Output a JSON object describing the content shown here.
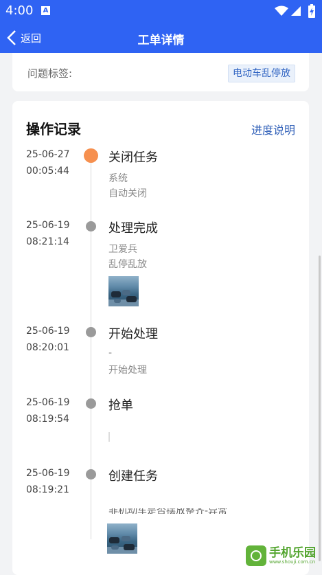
{
  "status_bar": {
    "time": "4:00",
    "notification_letter": "A"
  },
  "app_bar": {
    "back_label": "返回",
    "title": "工单详情"
  },
  "tag_card": {
    "label": "问题标签:",
    "tag": "电动车乱停放"
  },
  "log": {
    "title": "操作记录",
    "progress_link": "进度说明",
    "entries": [
      {
        "date": "25-06-27",
        "time": "00:05:44",
        "action": "关闭任务",
        "line1": "系统",
        "line2": "自动关闭"
      },
      {
        "date": "25-06-19",
        "time": "08:21:14",
        "action": "处理完成",
        "line1": "卫爱兵",
        "line2": "乱停乱放"
      },
      {
        "date": "25-06-19",
        "time": "08:20:01",
        "action": "开始处理",
        "line1": "-",
        "line2": "开始处理"
      },
      {
        "date": "25-06-19",
        "time": "08:19:54",
        "action": "抢单"
      },
      {
        "date": "25-06-19",
        "time": "08:19:21",
        "action": "创建任务",
        "line1": "非机动车是否摆放整齐-异常"
      }
    ]
  },
  "watermark": {
    "main": "手机乐园",
    "sub": "www.shouji.com.cn"
  },
  "colors": {
    "brand_blue": "#2f63f3",
    "active_dot": "#f6904f",
    "inactive_dot": "#9a9a9a",
    "link": "#2f5fb8"
  }
}
